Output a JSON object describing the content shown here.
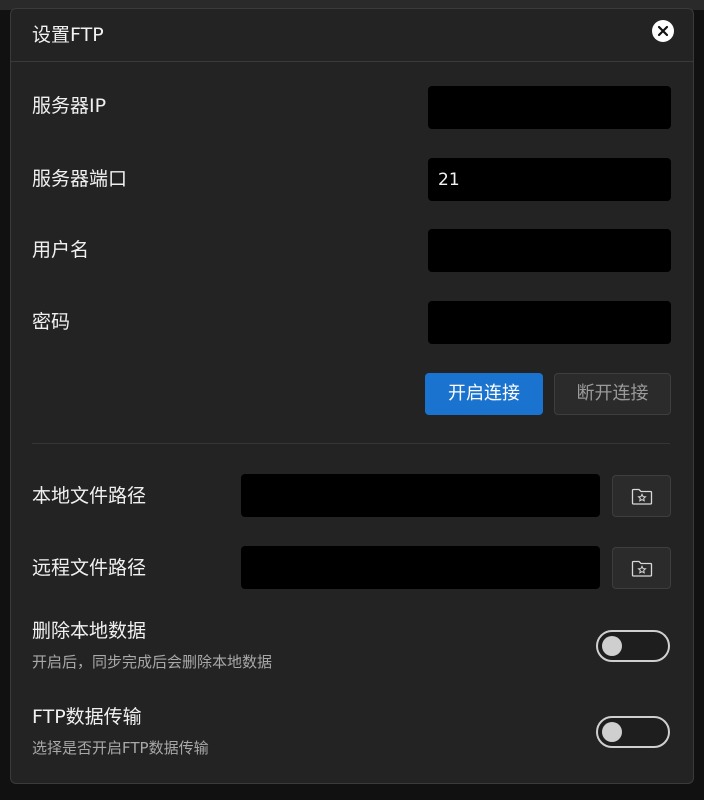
{
  "dialog": {
    "title": "设置FTP"
  },
  "connection": {
    "server_ip": {
      "label": "服务器IP",
      "value": ""
    },
    "server_port": {
      "label": "服务器端口",
      "value": "21"
    },
    "username": {
      "label": "用户名",
      "value": ""
    },
    "password": {
      "label": "密码",
      "value": ""
    },
    "connect_label": "开启连接",
    "disconnect_label": "断开连接"
  },
  "paths": {
    "local": {
      "label": "本地文件路径",
      "value": ""
    },
    "remote": {
      "label": "远程文件路径",
      "value": ""
    }
  },
  "options": {
    "delete_local": {
      "label": "删除本地数据",
      "description": "开启后，同步完成后会删除本地数据",
      "enabled": false
    },
    "ftp_transfer": {
      "label": "FTP数据传输",
      "description": "选择是否开启FTP数据传输",
      "enabled": false
    }
  },
  "colors": {
    "accent": "#1a73cf",
    "panel": "#232323",
    "input_bg": "#000000"
  },
  "icons": {
    "close": "close-icon",
    "folder": "folder-star-icon"
  }
}
